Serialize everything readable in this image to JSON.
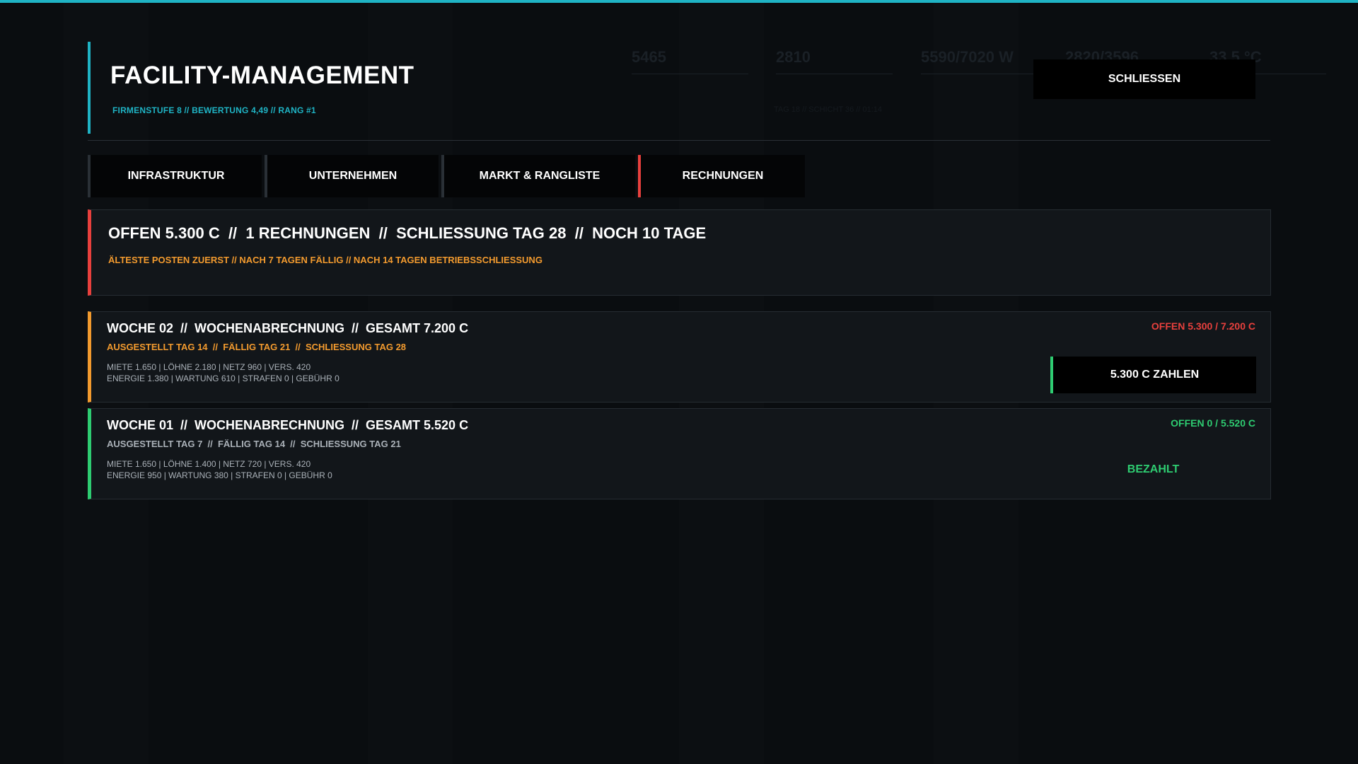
{
  "header": {
    "title": "FACILITY-MANAGEMENT",
    "subtitle": "FIRMENSTUFE 8 // BEWERTUNG 4,49 // RANG #1",
    "close_label": "SCHLIESSEN"
  },
  "tabs": [
    {
      "label": "INFRASTRUKTUR",
      "active": false
    },
    {
      "label": "UNTERNEHMEN",
      "active": false
    },
    {
      "label": "MARKT & RANGLISTE",
      "active": false
    },
    {
      "label": "RECHNUNGEN",
      "active": true
    }
  ],
  "summary": {
    "headline": "OFFEN 5.300 C  //  1 RECHNUNGEN  //  SCHLIESSUNG TAG 28  //  NOCH 10 TAGE",
    "rule": "ÄLTESTE POSTEN ZUERST // NACH 7 TAGEN FÄLLIG // NACH 14 TAGEN BETRIEBSSCHLIESSUNG"
  },
  "invoices": [
    {
      "title": "WOCHE 02  //  WOCHENABRECHNUNG  //  GESAMT 7.200 C",
      "dates": "AUSGESTELLT TAG 14  //  FÄLLIG TAG 21  //  SCHLIESSUNG TAG 28",
      "breakdown_line1": "MIETE 1.650 | LÖHNE 2.180 | NETZ 960 | VERS. 420",
      "breakdown_line2": "ENERGIE 1.380 | WARTUNG 610 | STRAFEN 0 | GEBÜHR 0",
      "status": "OFFEN 5.300 / 7.200 C",
      "action_label": "5.300 C ZAHLEN",
      "paid": false
    },
    {
      "title": "WOCHE 01  //  WOCHENABRECHNUNG  //  GESAMT 5.520 C",
      "dates": "AUSGESTELLT TAG 7  //  FÄLLIG TAG 14  //  SCHLIESSUNG TAG 21",
      "breakdown_line1": "MIETE 1.650 | LÖHNE 1.400 | NETZ 720 | VERS. 420",
      "breakdown_line2": "ENERGIE 950 | WARTUNG 380 | STRAFEN 0 | GEBÜHR 0",
      "status": "OFFEN 0 / 5.520 C",
      "action_label": "BEZAHLT",
      "paid": true
    }
  ],
  "background_hud": {
    "stats": [
      "5465",
      "2810",
      "5590/7020 W",
      "2820/3596",
      "33,5 °C"
    ],
    "clock": "TAG 18  //  SCHICHT 36  //  01:14"
  },
  "colors": {
    "accent": "#1fb3c4",
    "alert": "#e8403d",
    "warning": "#f29a2e",
    "success": "#2ecc71"
  }
}
